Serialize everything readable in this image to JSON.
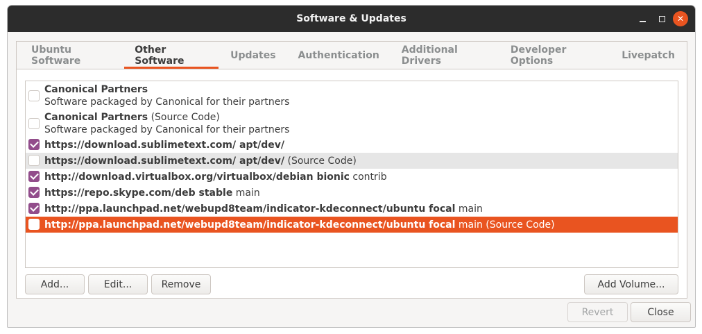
{
  "window": {
    "title": "Software & Updates",
    "controls": {
      "minimize": "minimize-icon",
      "maximize": "maximize-icon",
      "close": "close-icon"
    }
  },
  "tabs": [
    {
      "label": "Ubuntu Software",
      "active": false
    },
    {
      "label": "Other Software",
      "active": true
    },
    {
      "label": "Updates",
      "active": false
    },
    {
      "label": "Authentication",
      "active": false
    },
    {
      "label": "Additional Drivers",
      "active": false
    },
    {
      "label": "Developer Options",
      "active": false
    },
    {
      "label": "Livepatch",
      "active": false
    }
  ],
  "sources": [
    {
      "bold": "Canonical Partners",
      "rest": "",
      "desc": "Software packaged by Canonical for their partners",
      "checked": false,
      "state": "normal"
    },
    {
      "bold": "Canonical Partners",
      "rest": " (Source Code)",
      "desc": "Software packaged by Canonical for their partners",
      "checked": false,
      "state": "normal"
    },
    {
      "bold": "https://download.sublimetext.com/ apt/dev/",
      "rest": "",
      "checked": true,
      "state": "normal"
    },
    {
      "bold": "https://download.sublimetext.com/ apt/dev/",
      "rest": " (Source Code)",
      "checked": false,
      "state": "hover"
    },
    {
      "bold": "http://download.virtualbox.org/virtualbox/debian bionic",
      "rest": " contrib",
      "checked": true,
      "state": "normal"
    },
    {
      "bold": "https://repo.skype.com/deb stable",
      "rest": " main",
      "checked": true,
      "state": "normal"
    },
    {
      "bold": "http://ppa.launchpad.net/webupd8team/indicator-kdeconnect/ubuntu focal",
      "rest": " main",
      "checked": true,
      "state": "normal"
    },
    {
      "bold": "http://ppa.launchpad.net/webupd8team/indicator-kdeconnect/ubuntu focal",
      "rest": " main (Source Code)",
      "checked": false,
      "state": "selected"
    }
  ],
  "buttons": {
    "add": "Add...",
    "edit": "Edit...",
    "remove": "Remove",
    "add_volume": "Add Volume...",
    "revert": "Revert",
    "close": "Close"
  },
  "colors": {
    "accent": "#e95420",
    "checkbox": "#924d8b",
    "titlebar": "#2c2c2c"
  }
}
